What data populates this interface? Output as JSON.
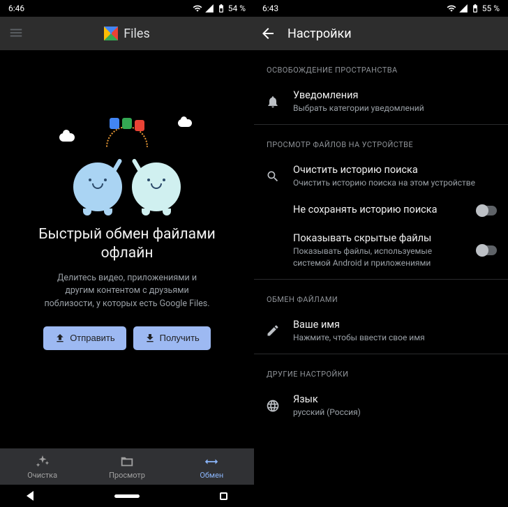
{
  "left": {
    "status": {
      "time": "6:46",
      "battery": "54 %"
    },
    "appbar": {
      "title": "Files"
    },
    "illustration": {
      "icons": [
        "doc-icon",
        "image-icon",
        "apk-icon"
      ],
      "cloud_count": 2
    },
    "headline": "Быстрый обмен файлами офлайн",
    "subtext": "Делитесь видео, приложениями и другим контентом с друзьями поблизости, у которых есть Google Files.",
    "buttons": {
      "send": "Отправить",
      "receive": "Получить"
    },
    "tabs": {
      "clean": "Очистка",
      "browse": "Просмотр",
      "share": "Обмен",
      "active": "share"
    }
  },
  "right": {
    "status": {
      "time": "6:43",
      "battery": "55 %"
    },
    "appbar": {
      "title": "Настройки"
    },
    "sections": {
      "space": {
        "header": "ОСВОБОЖДЕНИЕ ПРОСТРАНСТВА",
        "notifications": {
          "title": "Уведомления",
          "sub": "Выбрать категории уведомлений"
        }
      },
      "browse": {
        "header": "ПРОСМОТР ФАЙЛОВ НА УСТРОЙСТВЕ",
        "clear_history": {
          "title": "Очистить историю поиска",
          "sub": "Очистить историю поиска на этом устройстве"
        },
        "no_save_history": {
          "title": "Не сохранять историю поиска",
          "enabled": false
        },
        "show_hidden": {
          "title": "Показывать скрытые файлы",
          "sub": "Показывать файлы, используемые системой Android и приложениями",
          "enabled": false
        }
      },
      "share": {
        "header": "ОБМЕН ФАЙЛАМИ",
        "your_name": {
          "title": "Ваше имя",
          "sub": "Нажмите, чтобы ввести свое имя"
        }
      },
      "other": {
        "header": "ДРУГИЕ НАСТРОЙКИ",
        "language": {
          "title": "Язык",
          "sub": "русский (Россия)"
        }
      }
    }
  }
}
